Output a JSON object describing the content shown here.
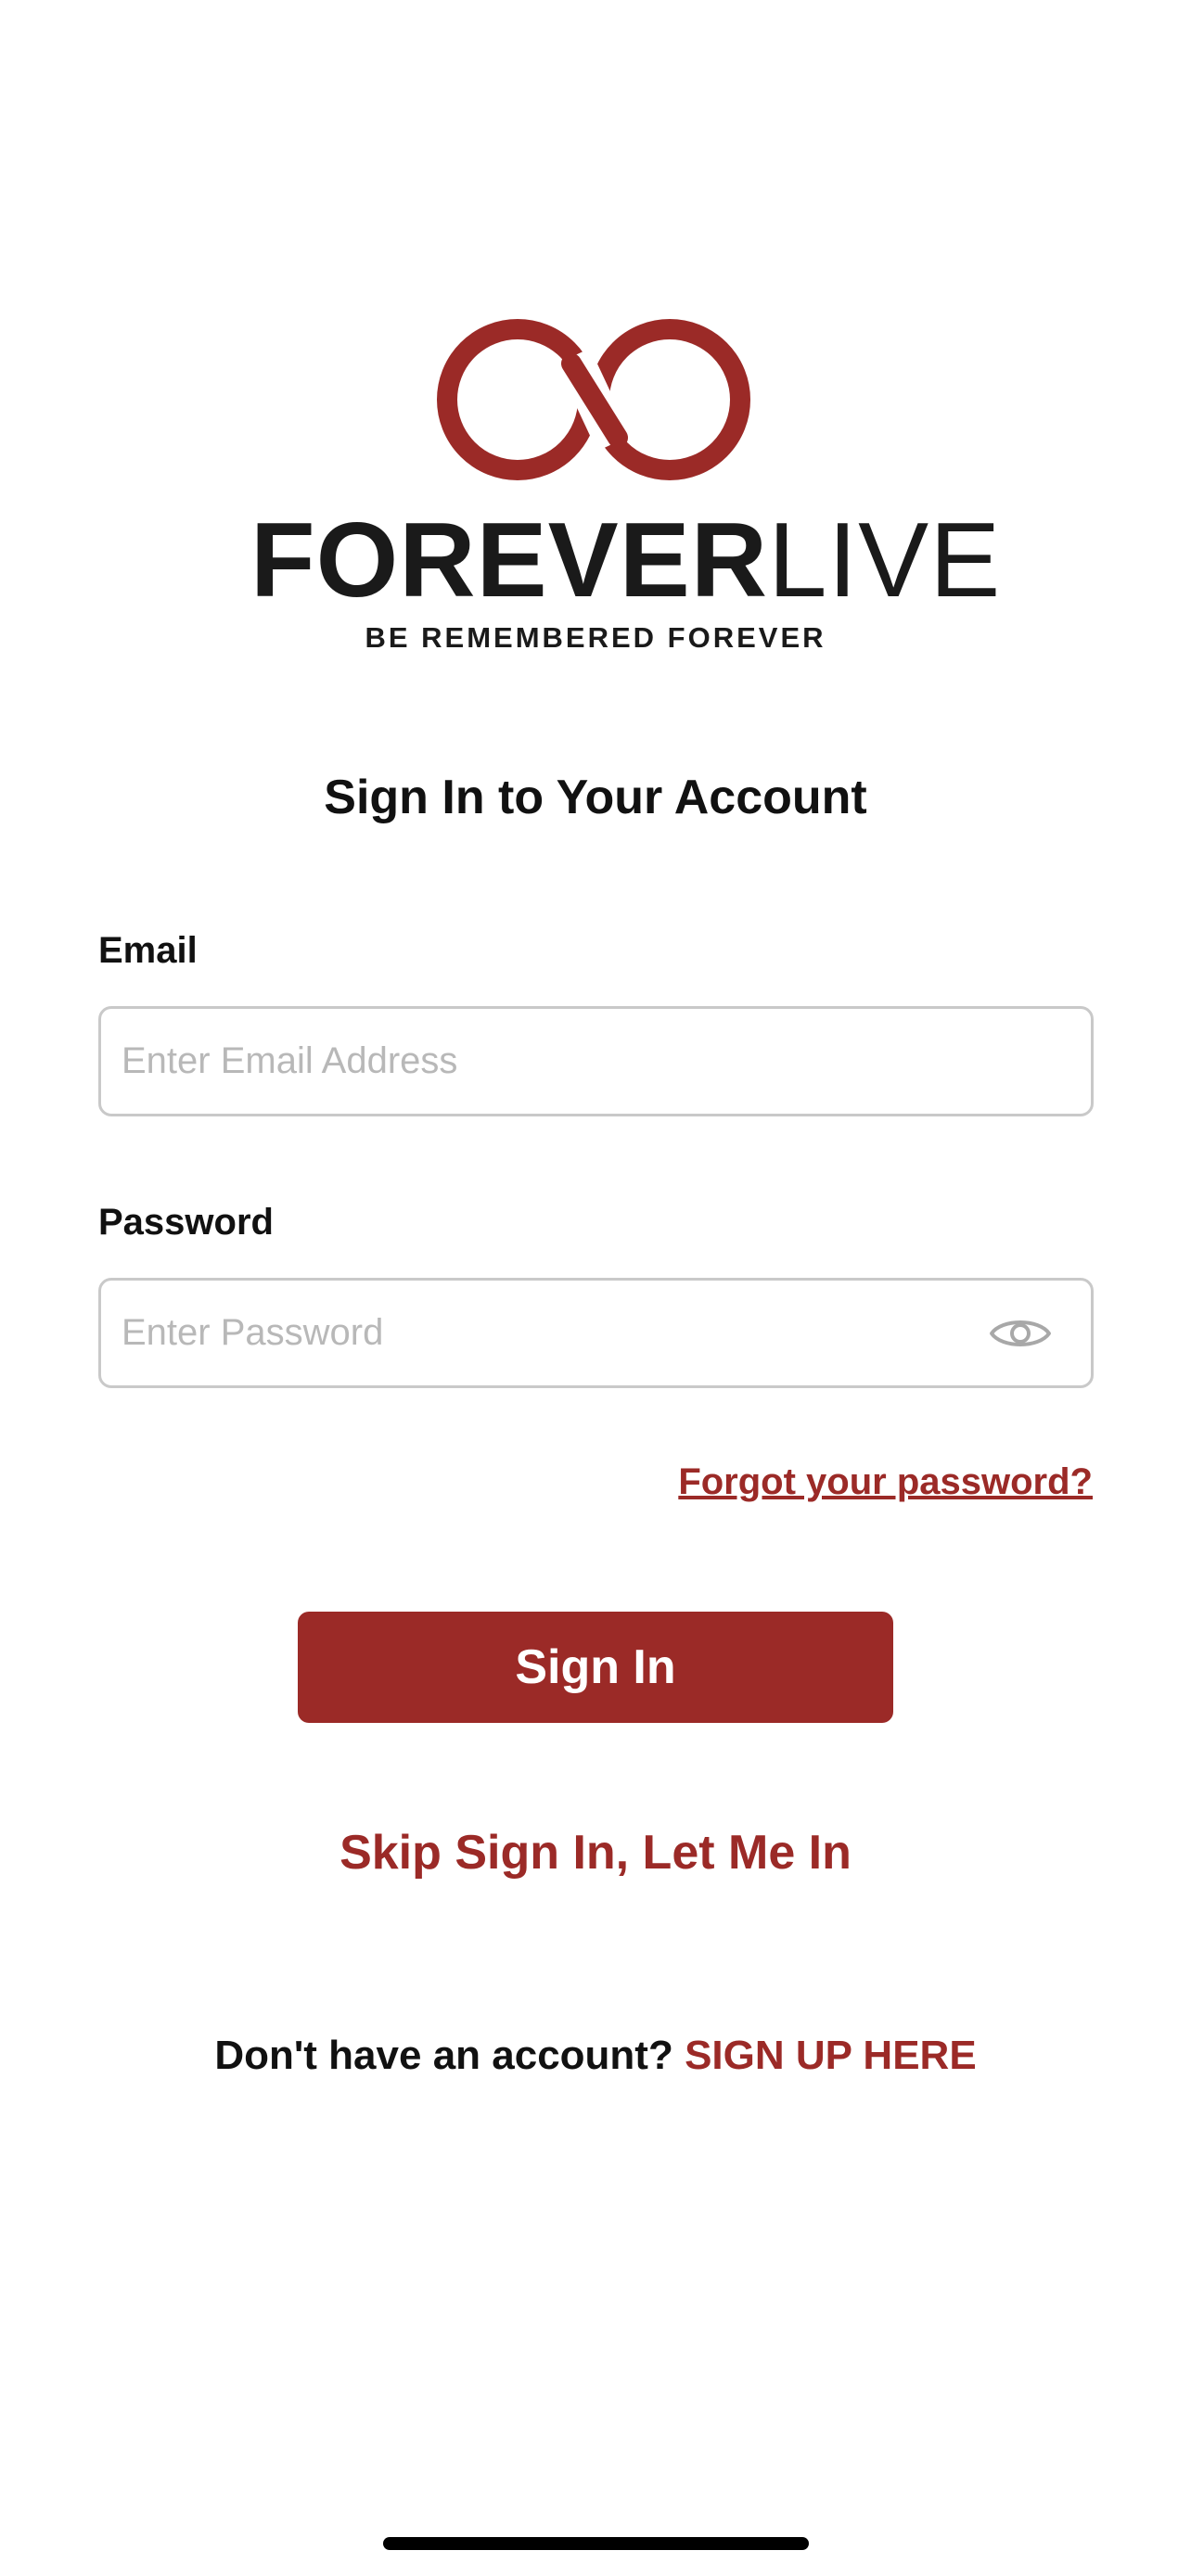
{
  "logo": {
    "wordmark_bold": "FOREVER",
    "wordmark_light": "LIVE",
    "tagline": "BE REMEMBERED FOREVER"
  },
  "page": {
    "title": "Sign In to Your Account"
  },
  "form": {
    "email": {
      "label": "Email",
      "value": "",
      "placeholder": "Enter Email Address"
    },
    "password": {
      "label": "Password",
      "value": "",
      "placeholder": "Enter Password",
      "toggle_icon": "eye-icon"
    },
    "forgot_password_label": "Forgot your password?",
    "sign_in_label": "Sign In",
    "skip_label": "Skip Sign In, Let Me In",
    "signup_prompt": "Don't have an account? ",
    "signup_link": "SIGN UP HERE"
  },
  "colors": {
    "brand": "#9b2a27",
    "text": "#111111",
    "input_border": "#c9c9c9",
    "placeholder": "#b8b8b8",
    "background": "#ffffff"
  }
}
